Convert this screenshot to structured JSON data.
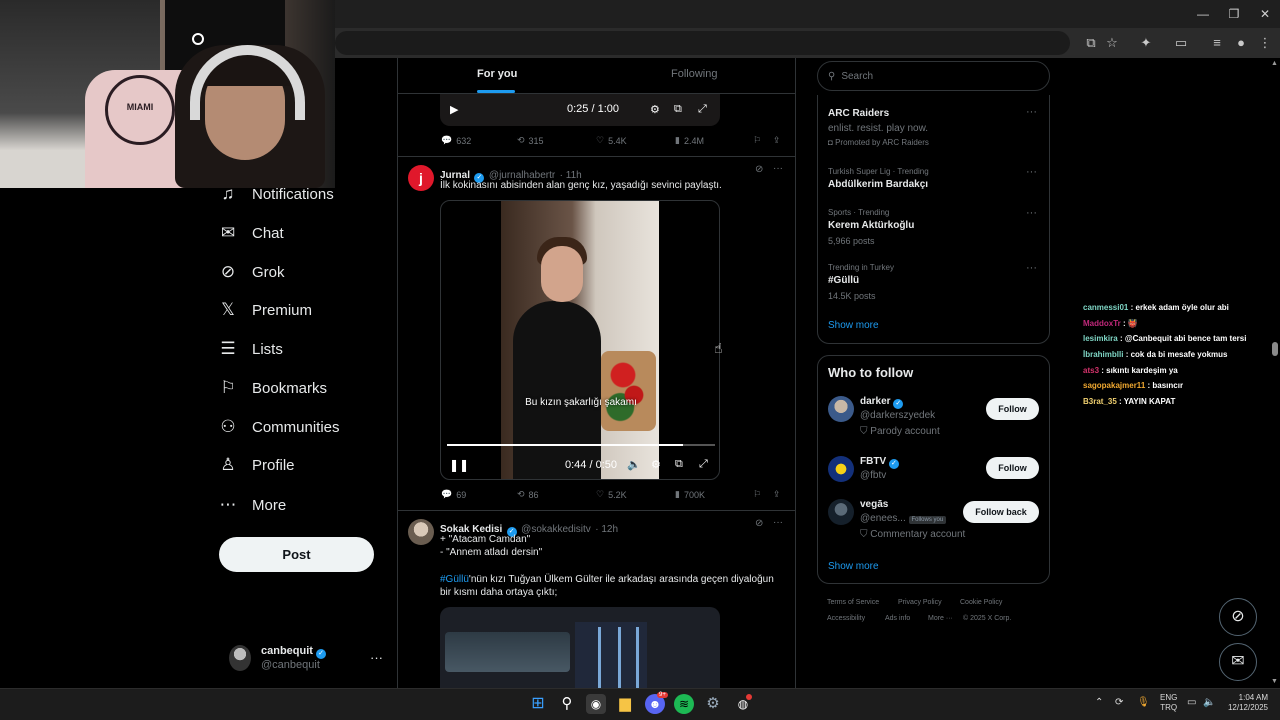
{
  "colors": {
    "accent": "#1d9bf0",
    "background": "#000000",
    "border": "#2f3336",
    "muted": "#71767b"
  },
  "nav": {
    "items": [
      {
        "label": "Notifications",
        "icon": "bell-icon"
      },
      {
        "label": "Chat",
        "icon": "mail-icon"
      },
      {
        "label": "Grok",
        "icon": "grok-icon"
      },
      {
        "label": "Premium",
        "icon": "x-logo-icon"
      },
      {
        "label": "Lists",
        "icon": "list-icon"
      },
      {
        "label": "Bookmarks",
        "icon": "bookmark-icon"
      },
      {
        "label": "Communities",
        "icon": "people-icon"
      },
      {
        "label": "Profile",
        "icon": "person-icon"
      },
      {
        "label": "More",
        "icon": "more-circle-icon"
      }
    ],
    "post_label": "Post",
    "account": {
      "name": "canbequit",
      "handle": "@canbequit"
    }
  },
  "tabs": {
    "for_you": "For you",
    "following": "Following"
  },
  "tweet_prev": {
    "video_time": "0:25 / 1:00",
    "actions": {
      "replies": "632",
      "reposts": "315",
      "likes": "5.4K",
      "views": "2.4M"
    }
  },
  "tweet1": {
    "name": "Jurnal",
    "handle": "@jurnalhabertr",
    "time": "· 11h",
    "text": "İlk kokinasını abisinden alan genç kız, yaşadığı sevinci paylaştı.",
    "caption": "Bu kızın şakarlığı şakamı",
    "video_time": "0:44 / 0:50",
    "progress": 0.88,
    "actions": {
      "replies": "69",
      "reposts": "86",
      "likes": "5.2K",
      "views": "700K"
    }
  },
  "tweet2": {
    "name": "Sokak Kedisi",
    "handle": "@sokakkedisitv",
    "time": "· 12h",
    "line1": "+ \"Atacam Camdan\"",
    "line2": "- \"Annem atladı dersin\"",
    "hashtag": "#Güllü",
    "line3": "'nün kızı Tuğyan Ülkem Gülter ile arkadaşı arasında geçen diyaloğun",
    "line4": "bir kısmı daha ortaya çıktı;"
  },
  "search": {
    "placeholder": "Search"
  },
  "trends": {
    "promo": {
      "name": "ARC Raiders",
      "tagline": "enlist. resist. play now.",
      "promoted": "Promoted by ARC Raiders"
    },
    "items": [
      {
        "meta": "Turkish Super Lig · Trending",
        "name": "Abdülkerim Bardakçı",
        "posts": ""
      },
      {
        "meta": "Sports · Trending",
        "name": "Kerem Aktürkoğlu",
        "posts": "5,966 posts"
      },
      {
        "meta": "Trending in Turkey",
        "name": "#Güllü",
        "posts": "14.5K posts"
      }
    ],
    "show_more": "Show more"
  },
  "who_to_follow": {
    "title": "Who to follow",
    "items": [
      {
        "name": "darker",
        "handle": "@darkerszyedek",
        "note": "Parody account",
        "button": "Follow"
      },
      {
        "name": "FBTV",
        "handle": "@fbtv",
        "note": "",
        "button": "Follow"
      },
      {
        "name": "vegās",
        "handle": "@enees...",
        "badge": "Follows you",
        "note": "Commentary account",
        "button": "Follow back"
      }
    ],
    "show_more": "Show more"
  },
  "footer": [
    "Terms of Service",
    "Privacy Policy",
    "Cookie Policy",
    "Accessibility",
    "Ads info",
    "More ···",
    "© 2025 X Corp."
  ],
  "chat": [
    {
      "user": "canmessi01",
      "msg": ": erkek adam öyle olur abi",
      "color": "#7fd6c5"
    },
    {
      "user": "MaddoxTr",
      "msg": ": 👹",
      "color": "#c0287a"
    },
    {
      "user": "lesimkira",
      "msg": ": @Canbequit abi bence tam tersi",
      "color": "#7fd6c5"
    },
    {
      "user": "İbrahimblli",
      "msg": ": cok da bi mesafe yokmus",
      "color": "#7fd6c5"
    },
    {
      "user": "ats3",
      "msg": ": sıkıntı kardeşim ya",
      "color": "#d6336c"
    },
    {
      "user": "sagopakajmer11",
      "msg": ": basıncır",
      "color": "#f0a830"
    },
    {
      "user": "B3rat_35",
      "msg": ": YAYIN KAPAT",
      "color": "#f0d070"
    }
  ],
  "webcam": {
    "shirt_text": "MIAMI"
  },
  "taskbar": {
    "lang": "ENG",
    "region": "TRQ",
    "time": "1:04 AM",
    "date": "12/12/2025",
    "discord_badge": "9+"
  }
}
